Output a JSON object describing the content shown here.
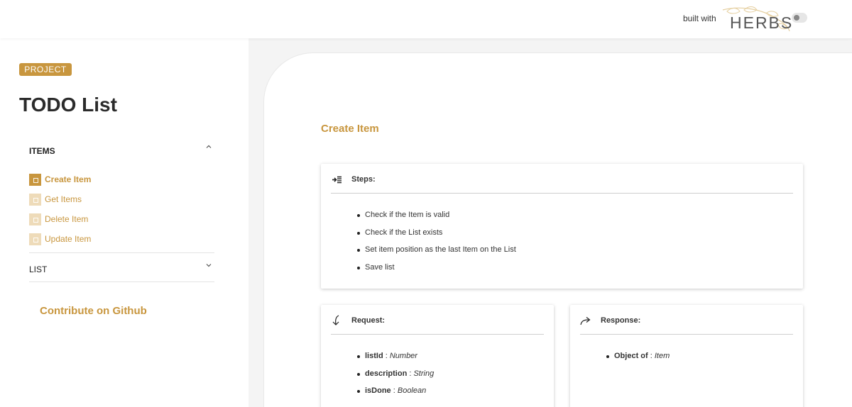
{
  "header": {
    "built_with": "built with",
    "logo_text": "HERBS",
    "theme_toggle_state": "off"
  },
  "sidebar": {
    "badge": "PROJECT",
    "title": "TODO List",
    "sections": [
      {
        "label": "ITEMS",
        "expanded": true,
        "items": [
          {
            "label": "Create Item",
            "active": true
          },
          {
            "label": "Get Items",
            "active": false
          },
          {
            "label": "Delete Item",
            "active": false
          },
          {
            "label": "Update Item",
            "active": false
          }
        ]
      },
      {
        "label": "LIST",
        "expanded": false,
        "items": []
      }
    ],
    "contribute": "Contribute on Github"
  },
  "main": {
    "title": "Create Item",
    "steps": {
      "title": "Steps:",
      "items": [
        "Check if the Item is valid",
        "Check if the List exists",
        "Set item position as the last Item on the List",
        "Save list"
      ]
    },
    "request": {
      "title": "Request:",
      "fields": [
        {
          "name": "listId",
          "sep": " : ",
          "type": "Number"
        },
        {
          "name": "description",
          "sep": " : ",
          "type": "String"
        },
        {
          "name": "isDone",
          "sep": " : ",
          "type": "Boolean"
        }
      ]
    },
    "response": {
      "title": "Response:",
      "fields": [
        {
          "name": "Object of",
          "sep": " : ",
          "type": "Item"
        }
      ]
    }
  },
  "colors": {
    "accent": "#c8963e",
    "accent_light": "#eedbb9",
    "main_bg": "#f4f4f4"
  },
  "icons": {
    "steps": "indent-list-icon",
    "request": "arrow-down-curved-icon",
    "response": "share-arrow-icon",
    "section_expanded": "chevron-up-icon",
    "section_collapsed": "chevron-down-icon"
  }
}
